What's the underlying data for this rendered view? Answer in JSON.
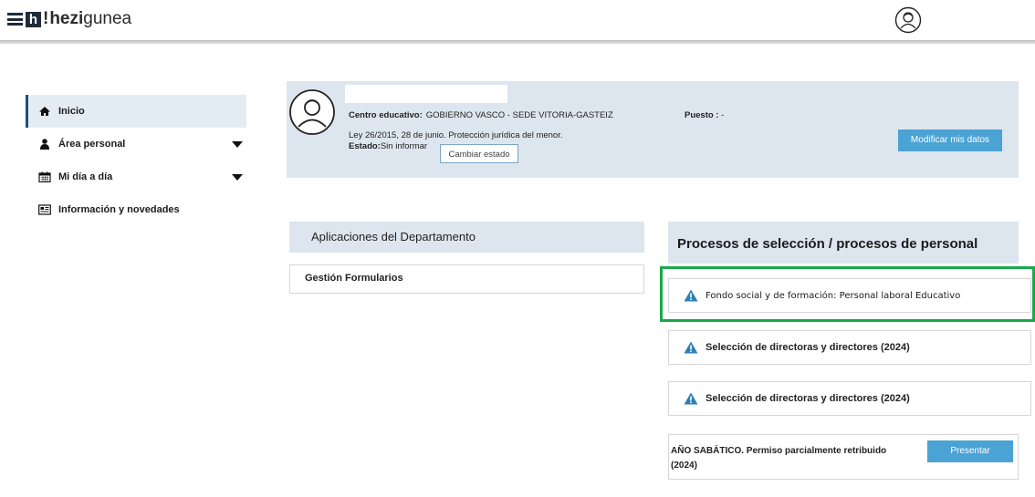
{
  "header": {
    "logo_bang": "!",
    "logo_brand_bold": "hezi",
    "logo_brand_rest": "gunea",
    "icons": {
      "menu": "hamburger-icon",
      "user": "user-circle-icon"
    }
  },
  "sidebar": {
    "items": [
      {
        "label": "Inicio",
        "icon": "home-icon",
        "active": true,
        "has_submenu": false
      },
      {
        "label": "Área personal",
        "icon": "person-icon",
        "active": false,
        "has_submenu": true
      },
      {
        "label": "Mi día a día",
        "icon": "calendar-icon",
        "active": false,
        "has_submenu": true
      },
      {
        "label": "Información y novedades",
        "icon": "news-icon",
        "active": false,
        "has_submenu": false
      }
    ]
  },
  "profile": {
    "name": "",
    "centro_label": "Centro educativo:",
    "centro_value": "GOBIERNO VASCO - SEDE VITORIA-GASTEIZ",
    "ley": "Ley 26/2015, 28 de junio. Protección jurídica del menor.",
    "estado_label": "Estado:",
    "estado_value": "Sin informar",
    "cambiar_estado_button": "Cambiar estado",
    "puesto_label": "Puesto :",
    "puesto_value": "-",
    "modificar_button": "Modificar mis datos"
  },
  "apps": {
    "title": "Aplicaciones del Departamento",
    "items": [
      "Gestión Formularios"
    ]
  },
  "procesos": {
    "title": "Procesos de selección / procesos de personal",
    "items": [
      "Fondo social y de formación: Personal laboral Educativo",
      "Selección de directoras y directores (2024)",
      "Selección de directoras y directores (2024)"
    ],
    "sabatico_text": "AÑO SABÁTICO. Permiso parcialmente retribuido (2024)",
    "presentar_button": "Presentar"
  },
  "colors": {
    "accent_button": "#4ba3d4",
    "panel_bg": "#dde6ee",
    "highlight_border": "#1ba84a",
    "warning_icon": "#2f7fb3"
  }
}
